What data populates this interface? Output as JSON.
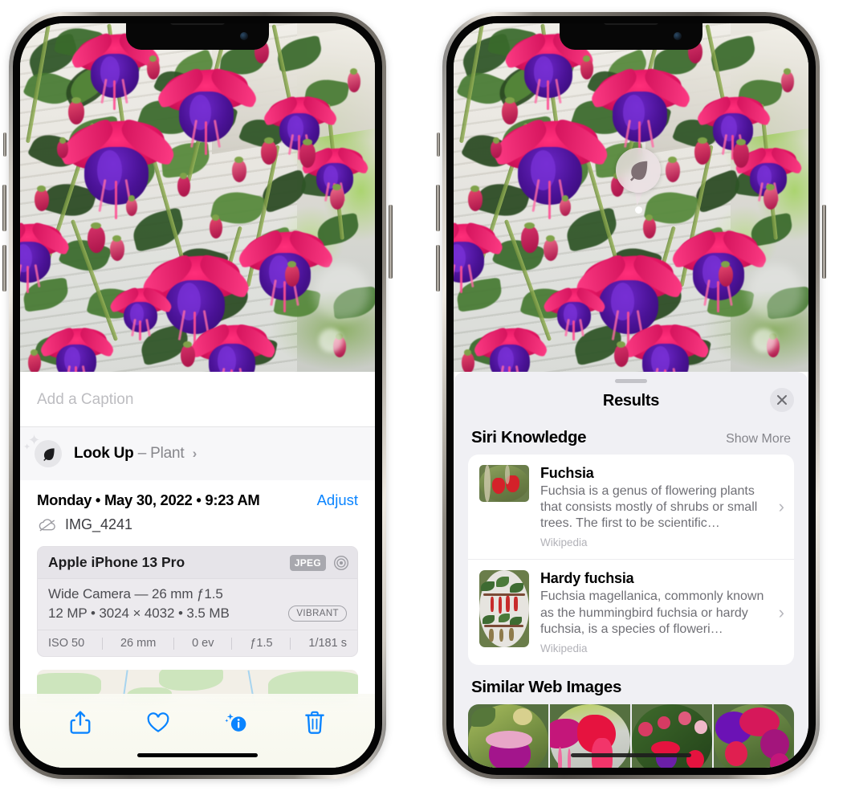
{
  "app": {
    "name": "Photos",
    "platform": "iOS"
  },
  "colors": {
    "accent_blue": "#0a84ff",
    "sheet_bg": "#f0f0f4",
    "card_bg": "#ffffff",
    "secondary_text": "#86868b",
    "badge_gray": "#a8a8ae"
  },
  "left_phone": {
    "photo": {
      "alt": "fuchsia-flowers-photo",
      "icon": "photo"
    },
    "caption": {
      "placeholder": "Add a Caption",
      "value": ""
    },
    "look_up": {
      "icon": "leaf-icon",
      "label": "Look Up",
      "dash": "–",
      "subject": "Plant",
      "chevron": "›"
    },
    "metadata": {
      "date_line": "Monday • May 30, 2022 • 9:23 AM",
      "adjust_label": "Adjust",
      "cloud_icon": "icloud-slash-icon",
      "filename": "IMG_4241"
    },
    "camera_card": {
      "device": "Apple iPhone 13 Pro",
      "format_badge": "JPEG",
      "aperture_icon": "aperture-icon",
      "lens_line": "Wide Camera — 26 mm ƒ1.5",
      "specs_line": "12 MP • 3024 × 4032 • 3.5 MB",
      "style_badge": "VIBRANT",
      "exif": [
        "ISO 50",
        "26 mm",
        "0 ev",
        "ƒ1.5",
        "1/181 s"
      ]
    },
    "map": {
      "label": "photo-location-map"
    },
    "toolbar": [
      {
        "name": "share-button",
        "icon": "share-icon"
      },
      {
        "name": "favorite-button",
        "icon": "heart-icon"
      },
      {
        "name": "info-button",
        "icon": "info-sparkle-icon"
      },
      {
        "name": "delete-button",
        "icon": "trash-icon"
      }
    ]
  },
  "right_phone": {
    "photo": {
      "alt": "fuchsia-flowers-photo"
    },
    "visual_lookup_badge": {
      "icon": "leaf-icon",
      "label": "Visual Look Up plant indicator"
    },
    "sheet": {
      "grabber": "drag-handle",
      "title": "Results",
      "close_icon": "close-icon"
    },
    "siri_knowledge": {
      "section_title": "Siri Knowledge",
      "show_more": "Show More",
      "items": [
        {
          "title": "Fuchsia",
          "description": "Fuchsia is a genus of flowering plants that consists mostly of shrubs or small trees. The first to be scientific…",
          "source": "Wikipedia",
          "chevron": "›"
        },
        {
          "title": "Hardy fuchsia",
          "description": "Fuchsia magellanica, commonly known as the hummingbird fuchsia or hardy fuchsia, is a species of floweri…",
          "source": "Wikipedia",
          "chevron": "›"
        }
      ]
    },
    "similar_web_images": {
      "section_title": "Similar Web Images",
      "thumbnails": [
        "fuchsia-web-image-1",
        "fuchsia-web-image-2",
        "fuchsia-web-image-3",
        "fuchsia-web-image-4"
      ]
    }
  }
}
